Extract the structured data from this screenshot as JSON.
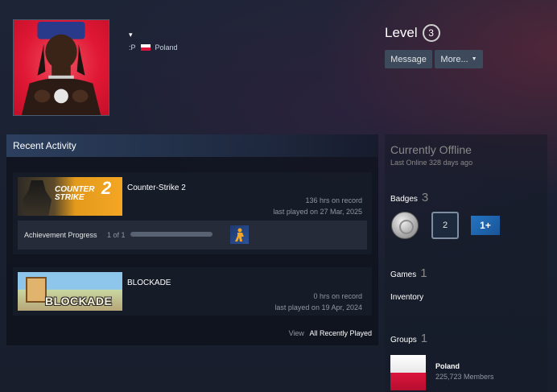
{
  "profile": {
    "persona_caret": "▾",
    "persona_handle": ":P",
    "country": "Poland"
  },
  "level": {
    "label": "Level",
    "value": "3"
  },
  "actions": {
    "message": "Message",
    "more": "More..."
  },
  "recent_activity": {
    "title": "Recent Activity",
    "games": [
      {
        "name": "Counter-Strike 2",
        "logo_text": "COUNTER STRIKE",
        "logo_number": "2",
        "hours": "136 hrs on record",
        "last_played": "last played on 27 Mar, 2025",
        "achievement": {
          "label": "Achievement Progress",
          "count": "1 of 1",
          "progress": 1.0
        }
      },
      {
        "name": "BLOCKADE",
        "logo_text": "BLOCKADE",
        "hours": "0 hrs on record",
        "last_played": "last played on 19 Apr, 2024"
      }
    ],
    "view_label": "View",
    "view_link": "All Recently Played"
  },
  "status": {
    "title": "Currently Offline",
    "last_online": "Last Online 328 days ago"
  },
  "badges": {
    "label": "Badges",
    "count": "3",
    "items": [
      {
        "icon": "coin-badge-icon",
        "text": ""
      },
      {
        "icon": "level-badge-icon",
        "text": "2"
      },
      {
        "icon": "years-badge-icon",
        "text": "1+"
      }
    ]
  },
  "games": {
    "label": "Games",
    "count": "1"
  },
  "inventory": {
    "label": "Inventory"
  },
  "groups": {
    "label": "Groups",
    "count": "1",
    "items": [
      {
        "name": "Poland",
        "members": "225,723 Members"
      }
    ]
  },
  "colors": {
    "accent_blue": "#2474c2",
    "poland_red": "#dc143c"
  }
}
